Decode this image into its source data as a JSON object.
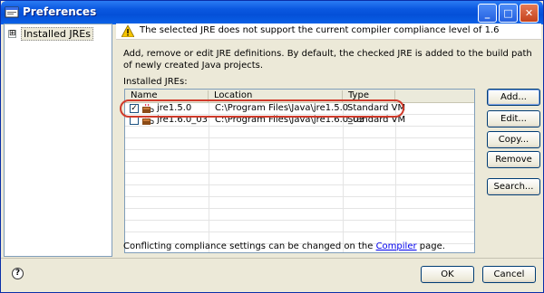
{
  "window": {
    "title": "Preferences"
  },
  "tree": {
    "items": [
      {
        "label": "Installed JREs",
        "expander": "⊞"
      }
    ]
  },
  "message": {
    "text": "The selected JRE does not support the current compiler compliance level of 1.6"
  },
  "description": "Add, remove or edit JRE definitions. By default, the checked JRE is added to the build path of newly created Java projects.",
  "installed_label": "Installed JREs:",
  "table": {
    "headers": {
      "name": "Name",
      "location": "Location",
      "type": "Type"
    },
    "rows": [
      {
        "name": "jre1.5.0",
        "location": "C:\\Program Files\\Java\\jre1.5.0",
        "type": "Standard VM",
        "checked": true
      },
      {
        "name": "jre1.6.0_03",
        "location": "C:\\Program Files\\Java\\jre1.6.0_03",
        "type": "Standard VM",
        "checked": false
      }
    ]
  },
  "buttons": {
    "add": "Add...",
    "edit": "Edit...",
    "copy": "Copy...",
    "remove": "Remove",
    "search": "Search..."
  },
  "footnote": {
    "before": "Conflicting compliance settings can be changed on the ",
    "link": "Compiler",
    "after": " page."
  },
  "dialog": {
    "ok": "OK",
    "cancel": "Cancel"
  },
  "titlebar_buttons": {
    "minimize": "_",
    "maximize": "□",
    "close": "✕"
  },
  "icons": {
    "help": "?",
    "warning": "warning-icon",
    "java": "java-icon"
  },
  "colors": {
    "titlebar": "#0a58e0",
    "highlight_circle": "#d03a2a",
    "link": "#0000ee"
  }
}
